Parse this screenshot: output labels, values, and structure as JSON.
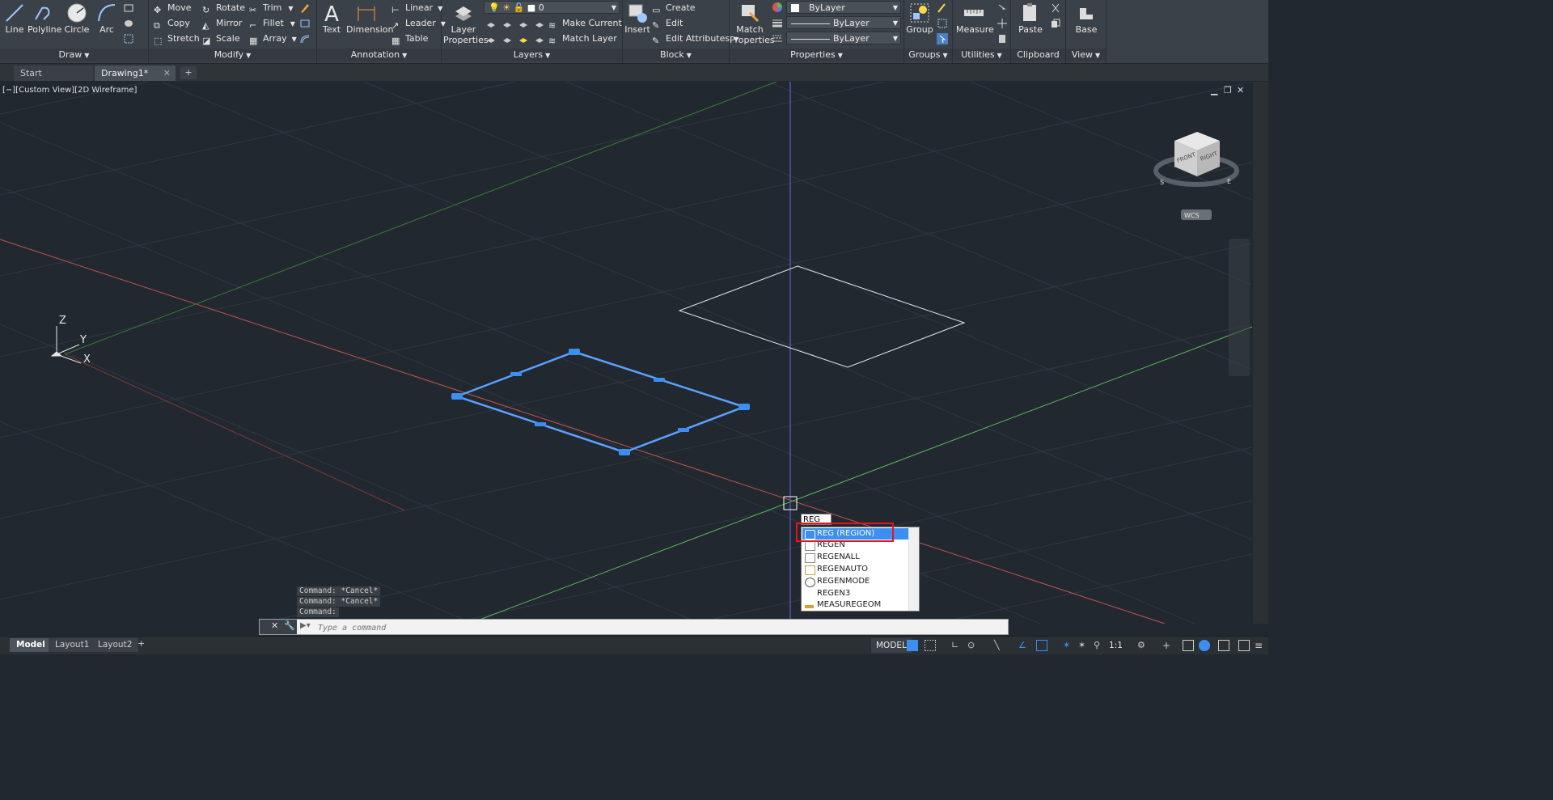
{
  "ribbon": {
    "draw": {
      "title": "Draw",
      "line": "Line",
      "polyline": "Polyline",
      "circle": "Circle",
      "arc": "Arc"
    },
    "modify": {
      "title": "Modify",
      "move": "Move",
      "rotate": "Rotate",
      "trim": "Trim",
      "copy": "Copy",
      "mirror": "Mirror",
      "fillet": "Fillet",
      "stretch": "Stretch",
      "scale": "Scale",
      "array": "Array"
    },
    "annotation": {
      "title": "Annotation",
      "text": "Text",
      "dimension": "Dimension",
      "linear": "Linear",
      "leader": "Leader",
      "table": "Table"
    },
    "layers": {
      "title": "Layers",
      "layer_properties_1": "Layer",
      "layer_properties_2": "Properties",
      "current_layer": "0",
      "make_current": "Make Current",
      "match_layer": "Match Layer"
    },
    "block": {
      "title": "Block",
      "insert": "Insert",
      "create": "Create",
      "edit": "Edit",
      "edit_attributes": "Edit Attributes"
    },
    "properties": {
      "title": "Properties",
      "match_1": "Match",
      "match_2": "Properties",
      "color": "ByLayer",
      "linetype": "ByLayer",
      "lineweight": "ByLayer"
    },
    "groups": {
      "title": "Groups",
      "group": "Group"
    },
    "utilities": {
      "title": "Utilities",
      "measure": "Measure"
    },
    "clipboard": {
      "title": "Clipboard",
      "paste": "Paste"
    },
    "view": {
      "title": "View",
      "base": "Base"
    }
  },
  "tabs": [
    {
      "label": "Start"
    },
    {
      "label": "Drawing1*"
    }
  ],
  "viewport": {
    "label": "[−][Custom View][2D Wireframe]",
    "ucs_z": "Z",
    "ucs_y": "Y",
    "ucs_x": "X",
    "viewcube_front": "FRONT",
    "viewcube_right": "RIGHT",
    "viewcube_s": "S",
    "viewcube_e": "E",
    "wcs": "WCS"
  },
  "command": {
    "history": [
      "Command: *Cancel*",
      "Command: *Cancel*",
      "Command:"
    ],
    "placeholder": "Type a command",
    "typed": "REG"
  },
  "autocomplete": {
    "items": [
      {
        "label": "REG (REGION)",
        "selected": true
      },
      {
        "label": "REGEN"
      },
      {
        "label": "REGENALL"
      },
      {
        "label": "REGENAUTO"
      },
      {
        "label": "REGENMODE"
      },
      {
        "label": "REGEN3"
      },
      {
        "label": "MEASUREGEOM"
      }
    ]
  },
  "layout_tabs": [
    {
      "label": "Model",
      "active": true
    },
    {
      "label": "Layout1"
    },
    {
      "label": "Layout2"
    }
  ],
  "status": {
    "model": "MODEL",
    "scale": "1:1"
  },
  "colors": {
    "ribbon": "#3b4148",
    "viewport": "#212830",
    "selection": "#3c8ef0",
    "highlight": "#e8141c",
    "x_axis": "#d9534f",
    "y_axis": "#5cb85c"
  }
}
